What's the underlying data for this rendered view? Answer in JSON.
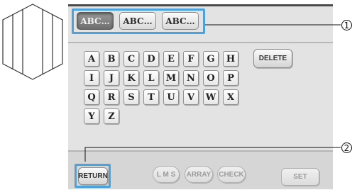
{
  "font_tabs": [
    {
      "label": "ABC",
      "state": "selected"
    },
    {
      "label": "ABC",
      "state": "normal"
    },
    {
      "label": "ABC",
      "state": "normal"
    }
  ],
  "letters": {
    "row1": [
      "A",
      "B",
      "C",
      "D",
      "E",
      "F",
      "G",
      "H"
    ],
    "row2": [
      "I",
      "J",
      "K",
      "L",
      "M",
      "N",
      "O",
      "P"
    ],
    "row3": [
      "Q",
      "R",
      "S",
      "T",
      "U",
      "V",
      "W",
      "X"
    ],
    "row4": [
      "Y",
      "Z"
    ]
  },
  "buttons": {
    "delete": "DELETE",
    "return": "RETURN",
    "lms": "L M S",
    "array": "ARRAY",
    "check": "CHECK",
    "set": "SET"
  },
  "callouts": {
    "one": "1",
    "two": "2"
  },
  "colors": {
    "highlight": "#4aa3dc",
    "panel": "#e3e3e3"
  }
}
